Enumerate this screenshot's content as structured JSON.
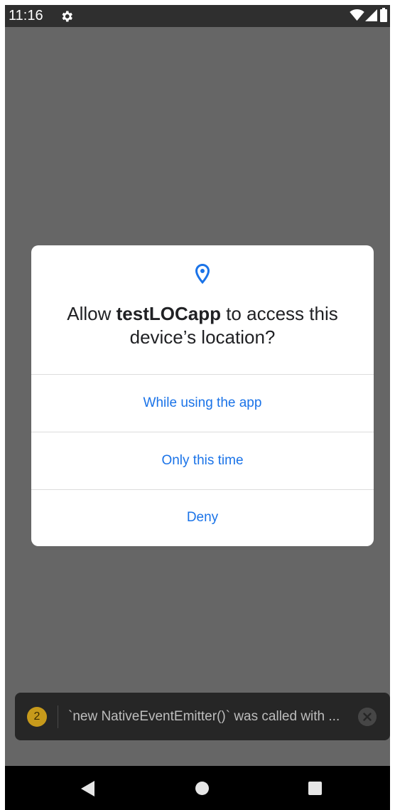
{
  "status_bar": {
    "time": "11:16",
    "icons": [
      "settings-icon",
      "wifi-icon",
      "signal-icon",
      "battery-icon"
    ]
  },
  "dialog": {
    "icon": "location-pin-icon",
    "title_prefix": "Allow ",
    "app_name": "testLOCapp",
    "title_suffix": " to access this device’s location?",
    "options": [
      {
        "label": "While using the app"
      },
      {
        "label": "Only this time"
      },
      {
        "label": "Deny"
      }
    ]
  },
  "toast": {
    "count": "2",
    "message": "`new NativeEventEmitter()` was called with ..."
  },
  "nav_bar": {
    "icons": [
      "back-icon",
      "home-icon",
      "recents-icon"
    ]
  },
  "colors": {
    "scrim": "#666666",
    "status_bar": "#2f2f2f",
    "accent": "#1a73e8",
    "badge": "#c79a1b"
  }
}
